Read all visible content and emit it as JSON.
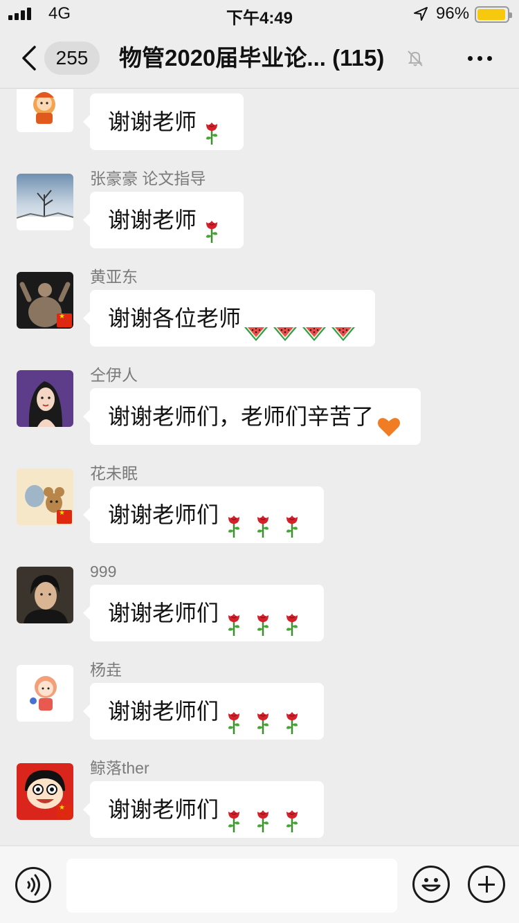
{
  "status_bar": {
    "carrier": "4G",
    "time": "下午4:49",
    "battery_percent": "96%"
  },
  "nav": {
    "unread_count": "255",
    "title": "物管2020届毕业论... (115)"
  },
  "icons": {
    "back": "chevron-left-icon",
    "mute": "bell-muted-icon",
    "more": "more-dots-icon",
    "voice": "voice-icon",
    "emoji": "emoji-face-icon",
    "plus": "plus-icon",
    "rose": "rose-emoji",
    "watermelon": "watermelon-emoji",
    "heart": "orange-heart-emoji"
  },
  "colors": {
    "background": "#ededed",
    "bubble": "#ffffff",
    "sender": "#7a7a7a",
    "battery": "#f6c90e"
  },
  "messages": [
    {
      "sender": "",
      "text": "谢谢老师",
      "emojis": [
        "rose"
      ]
    },
    {
      "sender": "张豪豪 论文指导",
      "text": "谢谢老师",
      "emojis": [
        "rose"
      ]
    },
    {
      "sender": "黄亚东",
      "text": "谢谢各位老师",
      "emojis": [
        "watermelon",
        "watermelon",
        "watermelon",
        "watermelon"
      ]
    },
    {
      "sender": "仝伊人",
      "text": "谢谢老师们，老师们辛苦了",
      "emojis": [
        "heart"
      ]
    },
    {
      "sender": "花未眠",
      "text": "谢谢老师们",
      "emojis": [
        "rose",
        "rose",
        "rose"
      ]
    },
    {
      "sender": "999",
      "text": "谢谢老师们",
      "emojis": [
        "rose",
        "rose",
        "rose"
      ]
    },
    {
      "sender": "杨垚",
      "text": "谢谢老师们",
      "emojis": [
        "rose",
        "rose",
        "rose"
      ]
    },
    {
      "sender": "鲸落ther",
      "text": "谢谢老师们",
      "emojis": [
        "rose",
        "rose",
        "rose"
      ]
    }
  ],
  "input": {
    "value": ""
  }
}
